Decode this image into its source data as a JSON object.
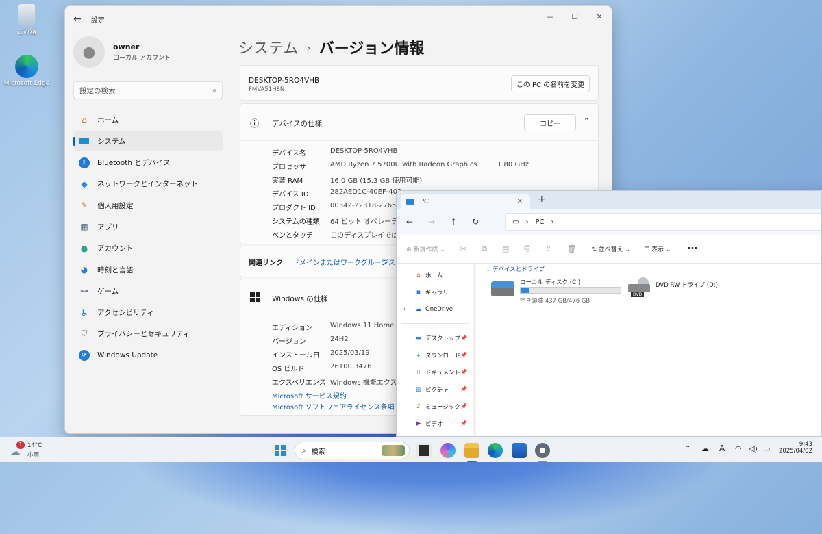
{
  "desktop": {
    "icons": [
      {
        "label": "ごみ箱"
      },
      {
        "label": "Microsoft Edge"
      }
    ]
  },
  "settings": {
    "title": "設定",
    "profile": {
      "name": "owner",
      "account": "ローカル アカウント"
    },
    "search_placeholder": "設定の検索",
    "nav": [
      {
        "label": "ホーム"
      },
      {
        "label": "システム"
      },
      {
        "label": "Bluetooth とデバイス"
      },
      {
        "label": "ネットワークとインターネット"
      },
      {
        "label": "個人用設定"
      },
      {
        "label": "アプリ"
      },
      {
        "label": "アカウント"
      },
      {
        "label": "時刻と言語"
      },
      {
        "label": "ゲーム"
      },
      {
        "label": "アクセシビリティ"
      },
      {
        "label": "プライバシーとセキュリティ"
      },
      {
        "label": "Windows Update"
      }
    ],
    "breadcrumb": {
      "parent": "システム",
      "current": "バージョン情報"
    },
    "device": {
      "name": "DESKTOP-5RO4VHB",
      "model": "FMVA51HSN",
      "rename_button": "この PC の名前を変更"
    },
    "device_spec": {
      "title": "デバイスの仕様",
      "copy_button": "コピー",
      "rows": [
        {
          "key": "デバイス名",
          "value": "DESKTOP-5RO4VHB",
          "extra": ""
        },
        {
          "key": "プロセッサ",
          "value": "AMD Ryzen 7 5700U with Radeon Graphics",
          "extra": "1.80 GHz"
        },
        {
          "key": "実装 RAM",
          "value": "16.0 GB (15.3 GB 使用可能)",
          "extra": ""
        },
        {
          "key": "デバイス ID",
          "value": "282AED1C-40EF-402",
          "extra": ""
        },
        {
          "key": "プロダクト ID",
          "value": "00342-22318-27658",
          "extra": ""
        },
        {
          "key": "システムの種類",
          "value": "64 ビット オペレーティン",
          "extra": ""
        },
        {
          "key": "ペンとタッチ",
          "value": "このディスプレイでは、ペ",
          "extra": ""
        }
      ]
    },
    "related_links": {
      "label": "関連リンク",
      "link1": "ドメインまたはワークグループ",
      "link2": "システ"
    },
    "windows_spec": {
      "title": "Windows の仕様",
      "rows": [
        {
          "key": "エディション",
          "value": "Windows 11 Home"
        },
        {
          "key": "バージョン",
          "value": "24H2"
        },
        {
          "key": "インストール日",
          "value": "2025/03/19"
        },
        {
          "key": "OS ビルド",
          "value": "26100.3476"
        },
        {
          "key": "エクスペリエンス",
          "value": "Windows 機能エクスペ"
        }
      ],
      "link1": "Microsoft サービス規約",
      "link2": "Microsoft ソフトウェアライセンス条項"
    }
  },
  "explorer": {
    "tab_title": "PC",
    "address": "PC",
    "commands": {
      "new": "新規作成",
      "sort": "並べ替え",
      "view": "表示"
    },
    "sidebar": [
      {
        "label": "ホーム",
        "pinned": false
      },
      {
        "label": "ギャラリー",
        "pinned": false
      },
      {
        "label": "OneDrive",
        "pinned": false
      },
      {
        "label": "デスクトップ",
        "pinned": true
      },
      {
        "label": "ダウンロード",
        "pinned": true
      },
      {
        "label": "ドキュメント",
        "pinned": true
      },
      {
        "label": "ピクチャ",
        "pinned": true
      },
      {
        "label": "ミュージック",
        "pinned": true
      },
      {
        "label": "ビデオ",
        "pinned": true
      }
    ],
    "section_title": "デバイスとドライブ",
    "drives": [
      {
        "name": "ローカル ディスク (C:)",
        "free": "空き領域 437 GB/476 GB",
        "used_fraction": 0.082
      },
      {
        "name": "DVD RW ドライブ (D:)",
        "badge": "DVD"
      }
    ]
  },
  "taskbar": {
    "weather": {
      "temp": "14°C",
      "condition": "小雨",
      "badge": "1"
    },
    "search": "検索",
    "clock": {
      "time": "9:43",
      "date": "2025/04/02"
    },
    "ime": "A"
  },
  "colors": {
    "accent": "#005fb8",
    "link": "#0f5bb5"
  }
}
